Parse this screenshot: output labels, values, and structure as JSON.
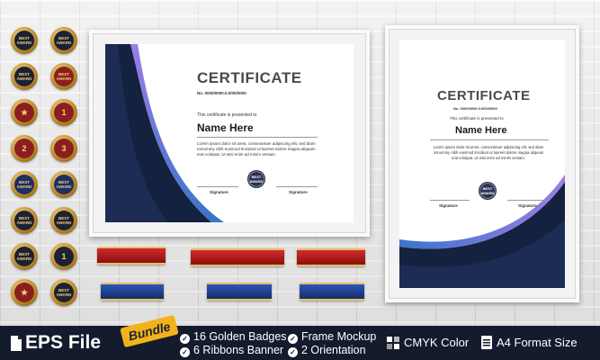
{
  "badges": {
    "best_label": "BEST",
    "award_label": "AWARD",
    "number_1": "1",
    "number_2": "2",
    "number_3": "3"
  },
  "certificate": {
    "title": "CERTIFICATE",
    "number": "No. 0000/0000.0.0/00/0000",
    "presented": "This certificate is presented to",
    "name": "Name Here",
    "body": "Lorem ipsum dolor sit amet, consectetuer adipiscing elit, sed diam nonummy nibh euismod tincidunt ut laoreet dolore magna aliquam erat volutpat. Ut wisi enim ad minim veniam.",
    "signature": "Signature"
  },
  "bar": {
    "eps": "EPS File",
    "bundle": "Bundle",
    "badges": "16 Golden Badges",
    "ribbons": "6  Ribbons Banner",
    "frame": "Frame Mockup",
    "orientation": "2 Orientation",
    "cmyk": "CMYK Color",
    "a4": "A4 Format Size"
  },
  "colors": {
    "navy": "#131b2d",
    "gold": "#f2b21a",
    "ribbon_red": "#b51d1d",
    "ribbon_blue": "#1f3a8a",
    "wave_purple": "#7c6bd8",
    "wave_blue": "#3b74c9"
  },
  "icons": [
    "file-icon",
    "check-circle-icon",
    "cmyk-grid-icon",
    "document-icon"
  ]
}
